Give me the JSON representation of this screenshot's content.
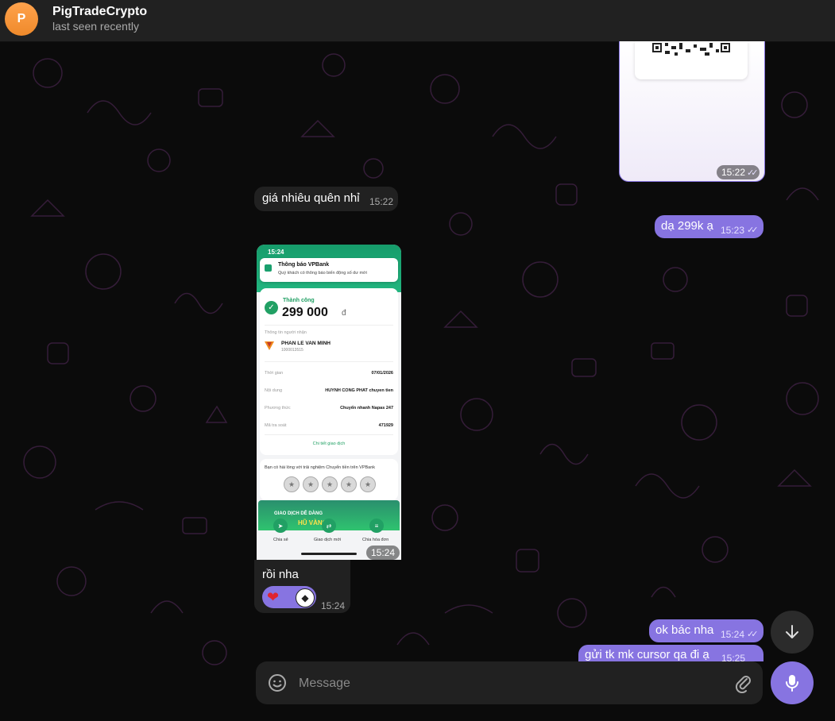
{
  "header": {
    "avatar_letter": "P",
    "title": "PigTradeCrypto",
    "status": "last seen recently"
  },
  "messages": {
    "qr_time": "15:22",
    "in1": {
      "text": "giá nhiêu quên nhỉ",
      "time": "15:22"
    },
    "out1": {
      "text": "dạ 299k ạ",
      "time": "15:23"
    },
    "screenshot_time": "15:24",
    "caption": {
      "text": "rồi nha",
      "time": "15:24"
    },
    "out2": {
      "text": "ok bác nha",
      "time": "15:24"
    },
    "out3": {
      "text": "gửi tk mk cursor qa đi ạ",
      "time": "15:25"
    }
  },
  "bank_screenshot": {
    "status_time": "15:24",
    "notif_title": "Thông báo VPBank",
    "notif_body": "Quý khách có thông báo biến động số dư mới",
    "success_label": "Thành công",
    "amount": "299 000",
    "currency": "đ",
    "recipient_label": "Thông tin người nhận",
    "recipient_name": "PHAN LE VAN MINH",
    "recipient_account": "1000013515",
    "rows": [
      {
        "label": "Thời gian",
        "value": "07/01/2026"
      },
      {
        "label": "Nội dung",
        "value": "HUYNH CONG PHAT chuyen tien"
      },
      {
        "label": "Phương thức",
        "value": "Chuyển nhanh Napas 247"
      },
      {
        "label": "Mã tra soát",
        "value": "471929"
      }
    ],
    "detail_link": "Chi tiết giao dịch",
    "rate_question": "Bạn có hài lòng với trải nghiệm Chuyển tiền trên VPBank",
    "promo_line1": "GIAO DỊCH DỄ DÀNG",
    "promo_line2": "HŨ VÀNG",
    "actions": [
      "Chia sẻ",
      "Giao dịch mới",
      "Chia hóa đơn"
    ]
  },
  "composer": {
    "placeholder": "Message"
  },
  "colors": {
    "outgoing": "#8774e1",
    "incoming": "#212121",
    "background": "#0b0b0b"
  }
}
